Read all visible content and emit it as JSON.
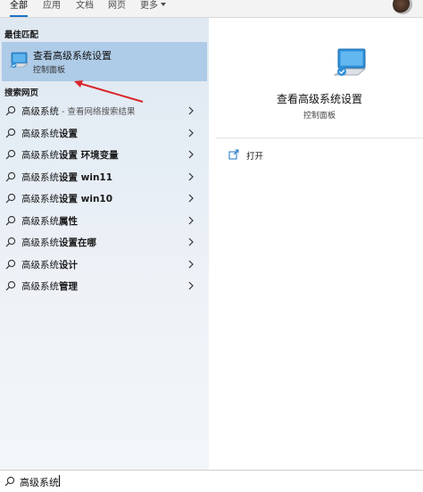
{
  "tabs": [
    {
      "label": "全部",
      "active": true
    },
    {
      "label": "应用"
    },
    {
      "label": "文档"
    },
    {
      "label": "网页"
    },
    {
      "label": "更多"
    }
  ],
  "best_match": {
    "section_title": "最佳匹配",
    "title": "查看高级系统设置",
    "subtitle": "控制面板",
    "icon": "monitor-check-icon"
  },
  "web": {
    "section_title": "搜索网页",
    "items": [
      {
        "prefix": "高级系统",
        "bold": "",
        "hint": " - 查看网络搜索结果"
      },
      {
        "prefix": "高级系统",
        "bold": "设置",
        "hint": ""
      },
      {
        "prefix": "高级系统",
        "bold": "设置 环境变量",
        "hint": ""
      },
      {
        "prefix": "高级系统",
        "bold": "设置 win11",
        "hint": ""
      },
      {
        "prefix": "高级系统",
        "bold": "设置 win10",
        "hint": ""
      },
      {
        "prefix": "高级系统",
        "bold": "属性",
        "hint": ""
      },
      {
        "prefix": "高级系统",
        "bold": "设置在哪",
        "hint": ""
      },
      {
        "prefix": "高级系统",
        "bold": "设计",
        "hint": ""
      },
      {
        "prefix": "高级系统",
        "bold": "管理",
        "hint": ""
      }
    ]
  },
  "preview": {
    "title": "查看高级系统设置",
    "subtitle": "控制面板",
    "actions": [
      {
        "label": "打开",
        "icon": "open-icon"
      }
    ]
  },
  "search": {
    "query": "高级系统"
  },
  "colors": {
    "selection": "#aecbe7",
    "accent": "#1a73c7",
    "annotation_arrow": "#d9262b"
  }
}
